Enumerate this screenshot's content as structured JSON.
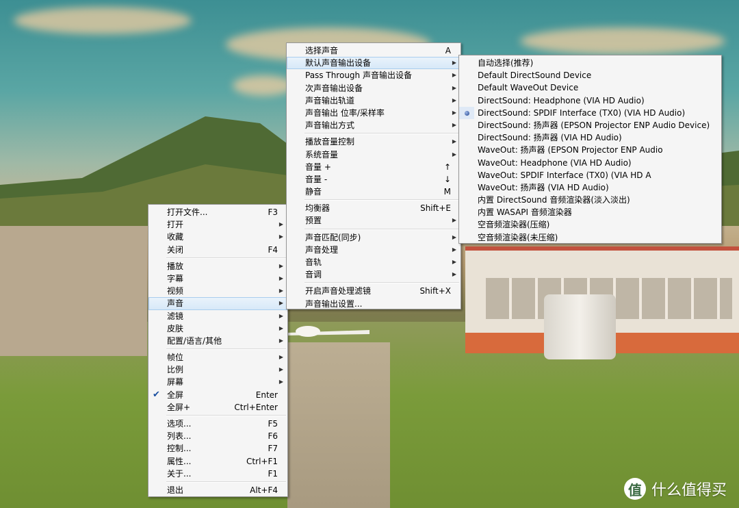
{
  "main_menu": [
    {
      "label": "打开文件...",
      "accel": "F3"
    },
    {
      "label": "打开",
      "submenu": true
    },
    {
      "label": "收藏",
      "submenu": true
    },
    {
      "label": "关闭",
      "accel": "F4"
    },
    {
      "sep": true
    },
    {
      "label": "播放",
      "submenu": true
    },
    {
      "label": "字幕",
      "submenu": true
    },
    {
      "label": "视频",
      "submenu": true
    },
    {
      "label": "声音",
      "submenu": true,
      "highlight": true
    },
    {
      "label": "滤镜",
      "submenu": true
    },
    {
      "label": "皮肤",
      "submenu": true
    },
    {
      "label": "配置/语言/其他",
      "submenu": true
    },
    {
      "sep": true
    },
    {
      "label": "帧位",
      "submenu": true
    },
    {
      "label": "比例",
      "submenu": true
    },
    {
      "label": "屏幕",
      "submenu": true
    },
    {
      "label": "全屏",
      "accel": "Enter",
      "checked": true
    },
    {
      "label": "全屏+",
      "accel": "Ctrl+Enter"
    },
    {
      "sep": true
    },
    {
      "label": "选项...",
      "accel": "F5"
    },
    {
      "label": "列表...",
      "accel": "F6"
    },
    {
      "label": "控制...",
      "accel": "F7"
    },
    {
      "label": "属性...",
      "accel": "Ctrl+F1"
    },
    {
      "label": "关于...",
      "accel": "F1"
    },
    {
      "sep": true
    },
    {
      "label": "退出",
      "accel": "Alt+F4"
    }
  ],
  "sound_menu": [
    {
      "label": "选择声音",
      "accel": "A"
    },
    {
      "label": "默认声音输出设备",
      "submenu": true,
      "highlight": true
    },
    {
      "label": "Pass Through 声音输出设备",
      "submenu": true
    },
    {
      "label": "次声音输出设备",
      "submenu": true
    },
    {
      "label": "声音输出轨道",
      "submenu": true
    },
    {
      "label": "声音输出 位率/采样率",
      "submenu": true
    },
    {
      "label": "声音输出方式",
      "submenu": true
    },
    {
      "sep": true
    },
    {
      "label": "播放音量控制",
      "submenu": true
    },
    {
      "label": "系统音量",
      "submenu": true
    },
    {
      "label": "音量 +",
      "accel": "↑"
    },
    {
      "label": "音量 -",
      "accel": "↓"
    },
    {
      "label": "静音",
      "accel": "M"
    },
    {
      "sep": true
    },
    {
      "label": "均衡器",
      "accel": "Shift+E"
    },
    {
      "label": "预置",
      "submenu": true
    },
    {
      "sep": true
    },
    {
      "label": "声音匹配(同步)",
      "submenu": true
    },
    {
      "label": "声音处理",
      "submenu": true
    },
    {
      "label": "音轨",
      "submenu": true
    },
    {
      "label": "音调",
      "submenu": true
    },
    {
      "sep": true
    },
    {
      "label": "开启声音处理滤镜",
      "accel": "Shift+X"
    },
    {
      "label": "声音输出设置..."
    }
  ],
  "device_menu": [
    {
      "label": "自动选择(推荐)"
    },
    {
      "label": "Default DirectSound Device"
    },
    {
      "label": "Default WaveOut Device"
    },
    {
      "label": "DirectSound: Headphone (VIA HD Audio)"
    },
    {
      "label": "DirectSound: SPDIF Interface (TX0) (VIA HD Audio)",
      "selected": true
    },
    {
      "label": "DirectSound: 扬声器 (EPSON Projector ENP Audio Device)"
    },
    {
      "label": "DirectSound: 扬声器 (VIA HD Audio)"
    },
    {
      "label": "WaveOut: 扬声器 (EPSON Projector ENP Audio"
    },
    {
      "label": "WaveOut: Headphone (VIA HD Audio)"
    },
    {
      "label": "WaveOut: SPDIF Interface (TX0) (VIA HD A"
    },
    {
      "label": "WaveOut: 扬声器 (VIA HD Audio)"
    },
    {
      "label": "内置 DirectSound 音频渲染器(淡入淡出)"
    },
    {
      "label": "内置 WASAPI 音频渲染器"
    },
    {
      "label": "空音频渲染器(压缩)"
    },
    {
      "label": "空音频渲染器(未压缩)"
    }
  ],
  "watermark": {
    "logo": "值",
    "text": "什么值得买"
  },
  "icons": {
    "submenu_arrow": "▶",
    "check": "✔"
  }
}
